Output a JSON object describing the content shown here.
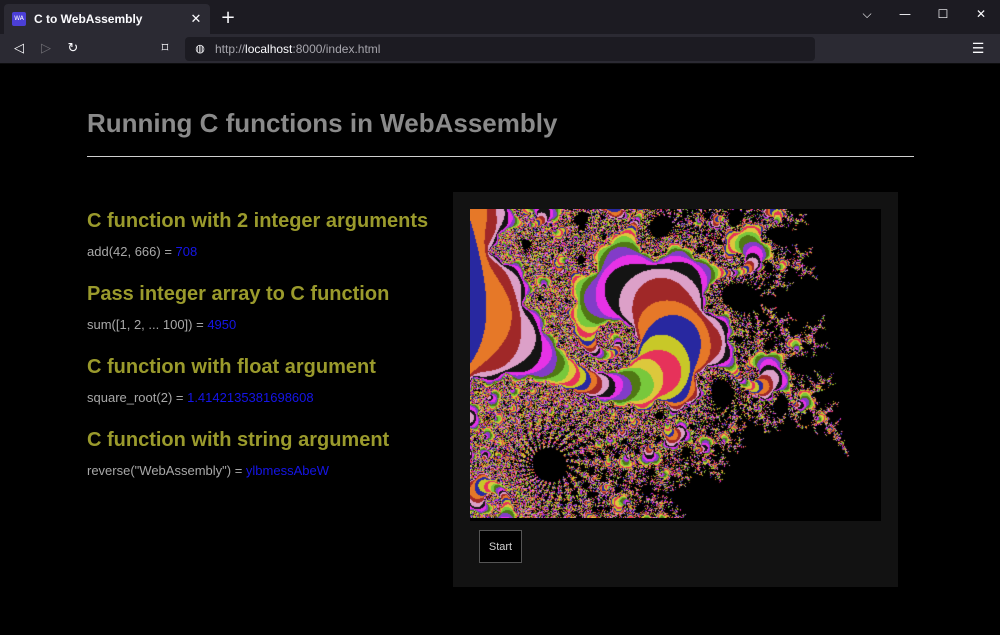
{
  "browser": {
    "tab_title": "C to WebAssembly",
    "favicon_text": "WA",
    "url_prefix": "http://",
    "url_host": "localhost",
    "url_rest": ":8000/index.html"
  },
  "page": {
    "title": "Running C functions in WebAssembly",
    "sections": [
      {
        "heading": "C function with 2 integer arguments",
        "expr": "add(42, 666) = ",
        "value": "708"
      },
      {
        "heading": "Pass integer array to C function",
        "expr": "sum([1, 2, ... 100]) = ",
        "value": "4950"
      },
      {
        "heading": "C function with float argument",
        "expr": "square_root(2) = ",
        "value": "1.4142135381698608"
      },
      {
        "heading": "C function with string argument",
        "expr": "reverse(\"WebAssembly\") = ",
        "value": "ylbmessAbeW"
      }
    ],
    "start_label": "Start"
  },
  "colors": {
    "heading": "#9a9a2c",
    "result_value": "#1515e8",
    "title": "#8a8a8a"
  }
}
